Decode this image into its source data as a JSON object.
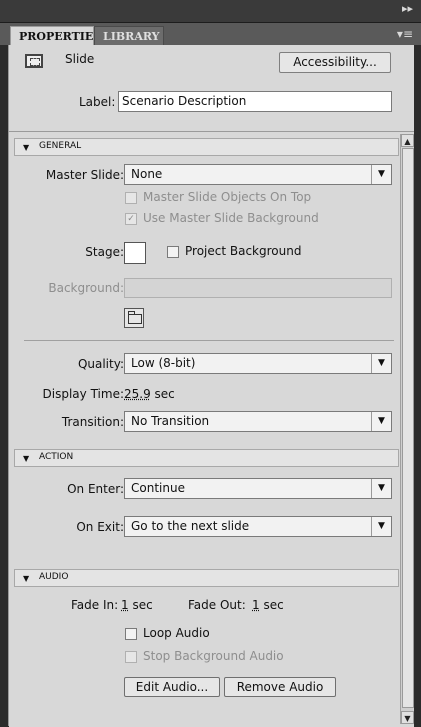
{
  "tabs": {
    "active": "PROPERTIES",
    "inactive": "LIBRARY"
  },
  "header": {
    "object_name": "Slide",
    "accessibility_button": "Accessibility...",
    "label_label": "Label:",
    "label_value": "Scenario Description"
  },
  "general": {
    "section_title": "GENERAL",
    "master_slide_label": "Master Slide:",
    "master_slide_value": "None",
    "master_objects_on_top": "Master Slide Objects On Top",
    "use_master_bg": "Use Master Slide Background",
    "stage_label": "Stage:",
    "project_background": "Project Background",
    "background_label": "Background:",
    "quality_label": "Quality:",
    "quality_value": "Low (8-bit)",
    "display_time_label": "Display Time:",
    "display_time_value": "25.9",
    "display_time_unit": "sec",
    "transition_label": "Transition:",
    "transition_value": "No Transition"
  },
  "action": {
    "section_title": "ACTION",
    "on_enter_label": "On Enter:",
    "on_enter_value": "Continue",
    "on_exit_label": "On Exit:",
    "on_exit_value": "Go to the next slide"
  },
  "audio": {
    "section_title": "AUDIO",
    "fade_in_label": "Fade In:",
    "fade_in_value": "1",
    "fade_in_unit": "sec",
    "fade_out_label": "Fade Out:",
    "fade_out_value": "1",
    "fade_out_unit": "sec",
    "loop_audio": "Loop Audio",
    "stop_bg_audio": "Stop Background Audio",
    "edit_audio_button": "Edit Audio...",
    "remove_audio_button": "Remove Audio"
  },
  "icons": [
    "panel-collapse-chevron-icon",
    "panel-menu-icon",
    "slide-icon",
    "section-collapse-triangle-icon",
    "dropdown-arrow-icon",
    "folder-icon",
    "scroll-up-arrow-icon",
    "scroll-down-arrow-icon"
  ]
}
